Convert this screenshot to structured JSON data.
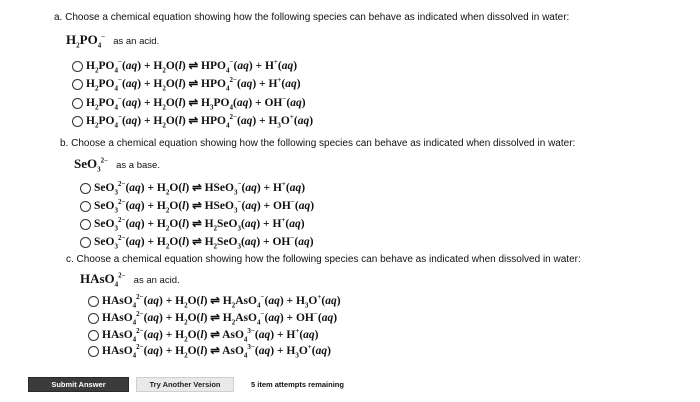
{
  "part_a": {
    "title": "a. Choose a chemical equation showing how the following species can behave as indicated when dissolved in water:",
    "species_html": "H<sub>2</sub>PO<sub>4</sub><sup>−</sup>",
    "note": "as an acid.",
    "options": [
      "H<sub>2</sub>PO<sub>4</sub><sup>−</sup>(<i>aq</i>) + H<sub>2</sub>O(<i>l</i>) ⇌ HPO<sub>4</sub><sup>−</sup>(<i>aq</i>) + H<sup>+</sup>(<i>aq</i>)",
      "H<sub>2</sub>PO<sub>4</sub><sup>−</sup>(<i>aq</i>) + H<sub>2</sub>O(<i>l</i>) ⇌ HPO<sub>4</sub><sup>2−</sup>(<i>aq</i>) + H<sup>+</sup>(<i>aq</i>)",
      "H<sub>2</sub>PO<sub>4</sub><sup>−</sup>(<i>aq</i>) + H<sub>2</sub>O(<i>l</i>) ⇌ H<sub>3</sub>PO<sub>4</sub>(<i>aq</i>) + OH<sup>−</sup>(<i>aq</i>)",
      "H<sub>2</sub>PO<sub>4</sub><sup>−</sup>(<i>aq</i>) + H<sub>2</sub>O(<i>l</i>) ⇌ HPO<sub>4</sub><sup>2−</sup>(<i>aq</i>) + H<sub>3</sub>O<sup>+</sup>(<i>aq</i>)"
    ]
  },
  "part_b": {
    "title": "b. Choose a chemical equation showing how the following species can behave as indicated when dissolved in water:",
    "species_html": "SeO<sub>3</sub><sup>2−</sup>",
    "note": "as a base.",
    "options": [
      "SeO<sub>3</sub><sup>2−</sup>(<i>aq</i>) + H<sub>2</sub>O(<i>l</i>) ⇌ HSeO<sub>3</sub><sup>−</sup>(<i>aq</i>) + H<sup>+</sup>(<i>aq</i>)",
      "SeO<sub>3</sub><sup>2−</sup>(<i>aq</i>) + H<sub>2</sub>O(<i>l</i>) ⇌ HSeO<sub>3</sub><sup>−</sup>(<i>aq</i>) + OH<sup>−</sup>(<i>aq</i>)",
      "SeO<sub>3</sub><sup>2−</sup>(<i>aq</i>) + H<sub>2</sub>O(<i>l</i>) ⇌ H<sub>2</sub>SeO<sub>3</sub>(<i>aq</i>) + H<sup>+</sup>(<i>aq</i>)",
      "SeO<sub>3</sub><sup>2−</sup>(<i>aq</i>) + H<sub>2</sub>O(<i>l</i>) ⇌ H<sub>2</sub>SeO<sub>3</sub>(<i>aq</i>) + OH<sup>−</sup>(<i>aq</i>)"
    ]
  },
  "part_c": {
    "title": "c. Choose a chemical equation showing how the following species can behave as indicated when dissolved in water:",
    "species_html": "HAsO<sub>4</sub><sup>2−</sup>",
    "note": "as an acid.",
    "options": [
      "HAsO<sub>4</sub><sup>2−</sup>(<i>aq</i>) + H<sub>2</sub>O(<i>l</i>) ⇌ H<sub>2</sub>AsO<sub>4</sub><sup>−</sup>(<i>aq</i>) + H<sub>3</sub>O<sup>+</sup>(<i>aq</i>)",
      "HAsO<sub>4</sub><sup>2−</sup>(<i>aq</i>) + H<sub>2</sub>O(<i>l</i>) ⇌ H<sub>2</sub>AsO<sub>4</sub><sup>−</sup>(<i>aq</i>) + OH<sup>−</sup>(<i>aq</i>)",
      "HAsO<sub>4</sub><sup>2−</sup>(<i>aq</i>) + H<sub>2</sub>O(<i>l</i>) ⇌ AsO<sub>4</sub><sup>3−</sup>(<i>aq</i>) + H<sup>+</sup>(<i>aq</i>)",
      "HAsO<sub>4</sub><sup>2−</sup>(<i>aq</i>) + H<sub>2</sub>O(<i>l</i>) ⇌ AsO<sub>4</sub><sup>3−</sup>(<i>aq</i>) + H<sub>3</sub>O<sup>+</sup>(<i>aq</i>)"
    ]
  },
  "footer": {
    "submit_label": "Submit Answer",
    "another_label": "Try Another Version",
    "attempts_text": "5 item attempts remaining"
  },
  "colors": {
    "submit_bg": "#3b3b3b",
    "another_bg": "#e9e9e9"
  }
}
